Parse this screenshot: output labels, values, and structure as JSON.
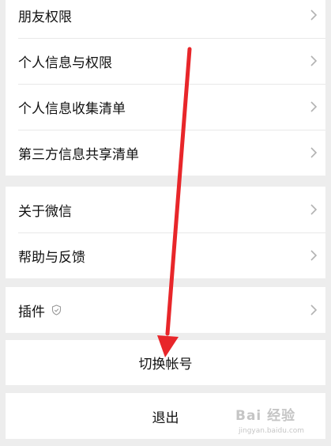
{
  "groups": [
    {
      "items": [
        {
          "label": "朋友权限"
        },
        {
          "label": "个人信息与权限"
        },
        {
          "label": "个人信息收集清单"
        },
        {
          "label": "第三方信息共享清单"
        }
      ]
    },
    {
      "items": [
        {
          "label": "关于微信"
        },
        {
          "label": "帮助与反馈"
        }
      ]
    },
    {
      "items": [
        {
          "label": "插件",
          "icon": "shield-icon"
        }
      ]
    }
  ],
  "switch_account": {
    "label": "切换帐号"
  },
  "logout": {
    "label": "退出"
  },
  "annotation": {
    "type": "arrow",
    "color": "#e8262a"
  },
  "watermark": {
    "main": "Bai 经验",
    "sub": "jingyan.baidu.com"
  },
  "colors": {
    "background": "#ededed",
    "card": "#ffffff",
    "chevron": "#b2b2b2"
  }
}
